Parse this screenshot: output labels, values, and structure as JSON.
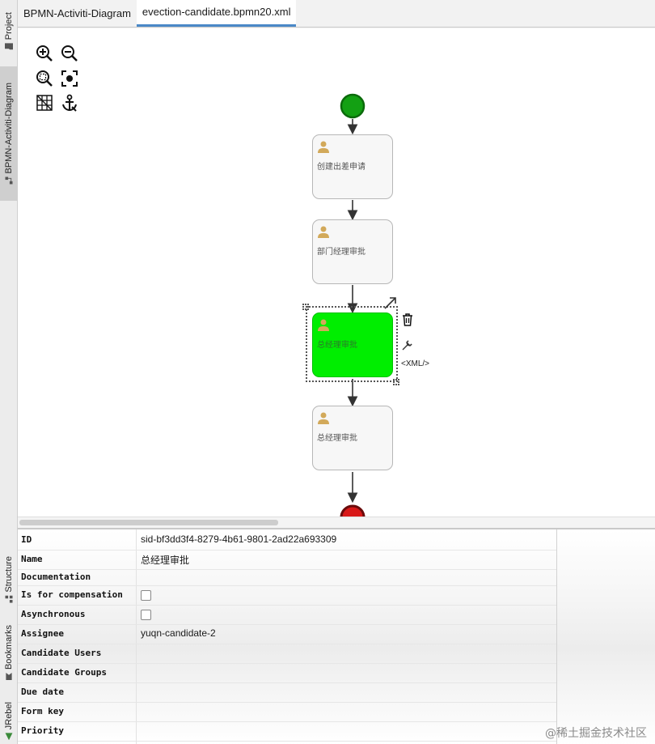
{
  "tabs": [
    {
      "label": "BPMN-Activiti-Diagram"
    },
    {
      "label": "evection-candidate.bpmn20.xml"
    }
  ],
  "left_strip": {
    "project": "Project",
    "bpmn": "BPMN-Activiti-Diagram",
    "structure": "Structure",
    "bookmarks": "Bookmarks",
    "jrebel": "JRebel"
  },
  "toolbar": {
    "zoom_in": "zoom-in-icon",
    "zoom_out": "zoom-out-icon",
    "zoom_fit": "zoom-fit-icon",
    "center": "center-icon",
    "grid": "grid-icon",
    "anchor": "anchor-icon"
  },
  "diagram": {
    "tasks": [
      {
        "label": "创建出差申请"
      },
      {
        "label": "部门经理审批"
      },
      {
        "label": "总经理审批"
      },
      {
        "label": "总经理审批"
      }
    ],
    "xml_link": "<XML/>",
    "colors": {
      "start": "#1a9a1a",
      "end": "#e02020",
      "active": "#00ee00"
    }
  },
  "properties": [
    {
      "name": "ID",
      "value": "sid-bf3dd3f4-8279-4b61-9801-2ad22a693309"
    },
    {
      "name": "Name",
      "value": "总经理审批"
    },
    {
      "name": "Documentation",
      "value": ""
    },
    {
      "name": "Is for compensation",
      "value": ""
    },
    {
      "name": "Asynchronous",
      "value": ""
    },
    {
      "name": "Assignee",
      "value": "yuqn-candidate-2"
    },
    {
      "name": "Candidate Users",
      "value": ""
    },
    {
      "name": "Candidate Groups",
      "value": ""
    },
    {
      "name": "Due date",
      "value": ""
    },
    {
      "name": "Form key",
      "value": ""
    },
    {
      "name": "Priority",
      "value": ""
    }
  ],
  "watermark": "@稀土掘金技术社区"
}
